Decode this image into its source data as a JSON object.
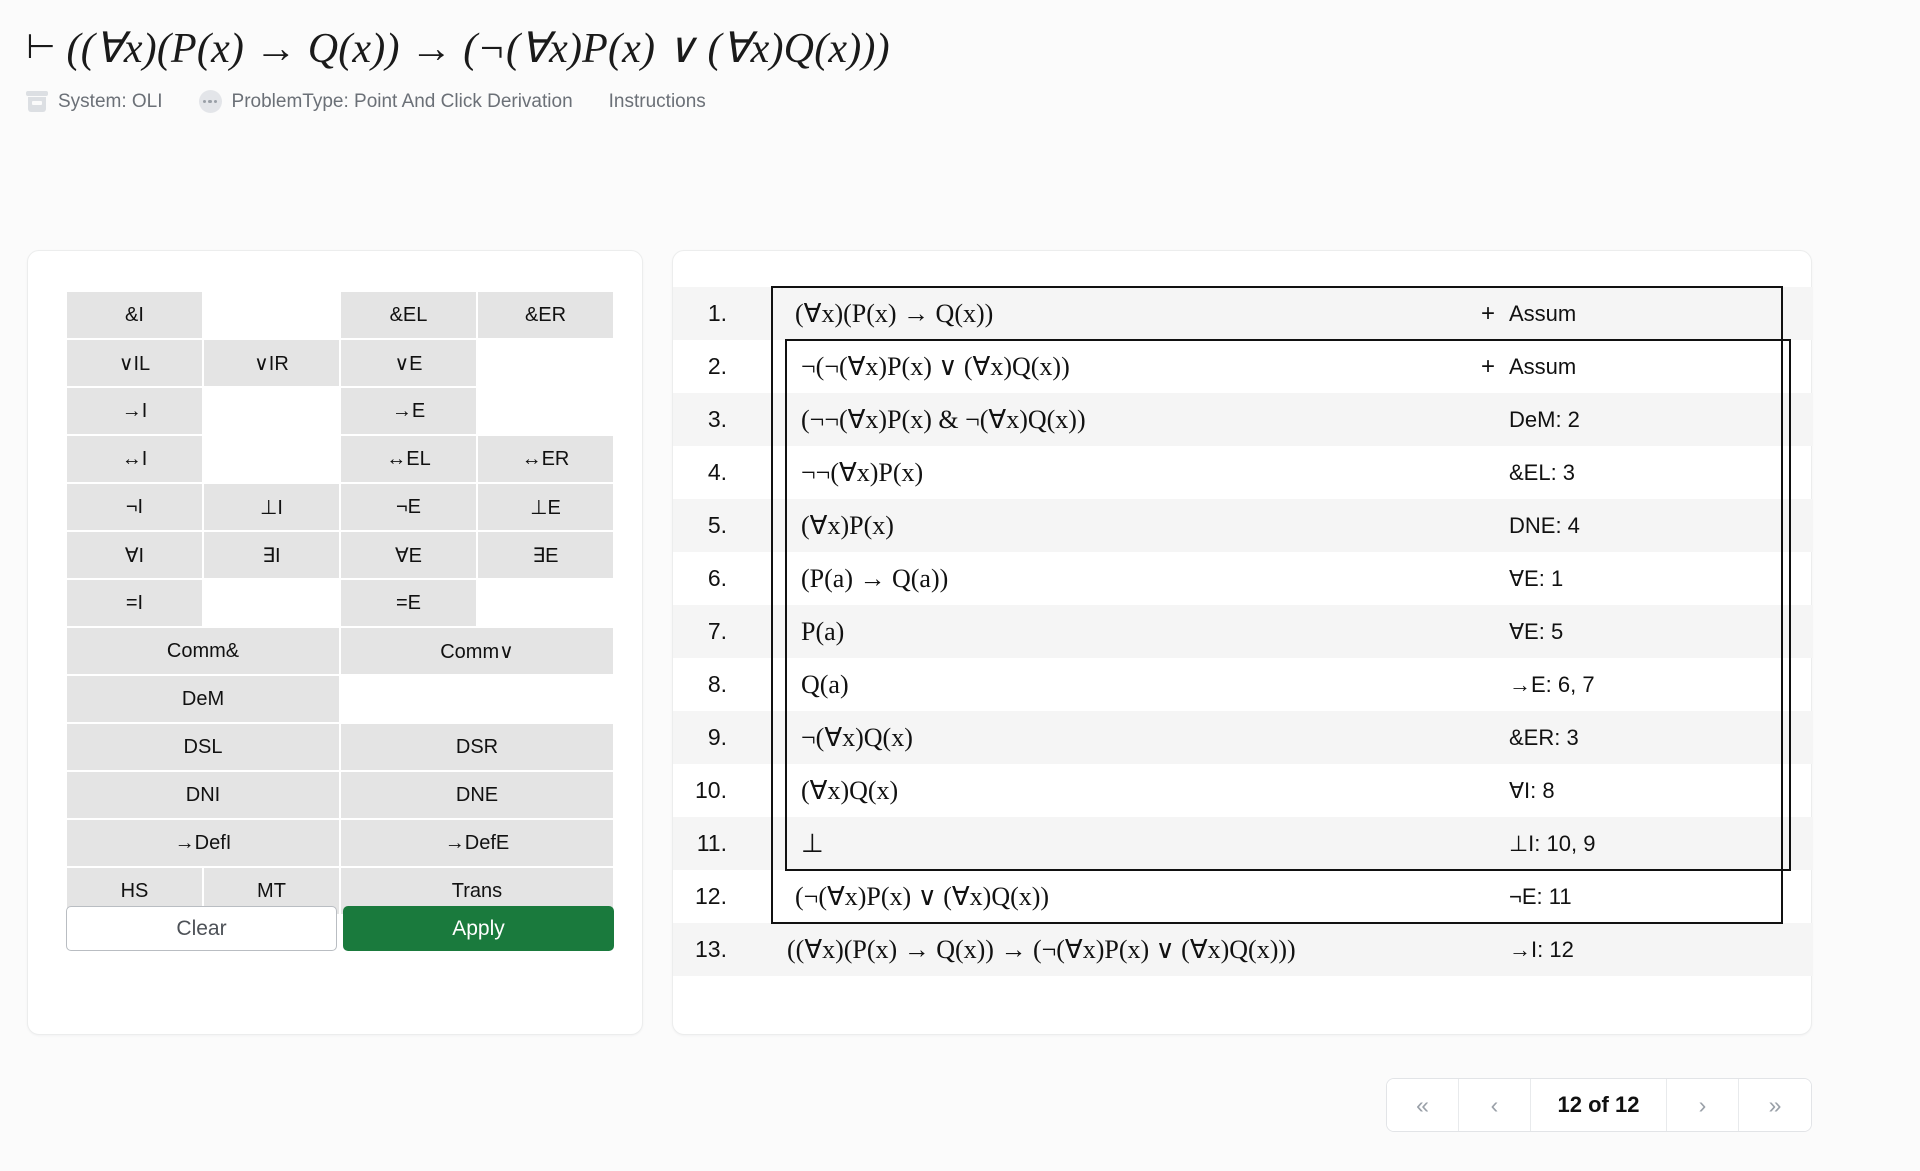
{
  "header": {
    "goal_turnstile": "⊢",
    "goal_formula": "((∀x)(P(x) → Q(x)) → (¬(∀x)P(x) ∨ (∀x)Q(x)))",
    "system_label": "System: OLI",
    "problem_type_label": "ProblemType: Point And Click Derivation",
    "instructions_label": "Instructions",
    "icons": {
      "system": "bucket-icon",
      "problem_type": "ellipsis-circle-icon"
    }
  },
  "rules_panel": {
    "rows": [
      [
        {
          "label": "&I",
          "span": 1
        },
        {
          "label": "",
          "span": 1,
          "empty": true
        },
        {
          "label": "&EL",
          "span": 1
        },
        {
          "label": "&ER",
          "span": 1
        }
      ],
      [
        {
          "label": "∨IL",
          "span": 1
        },
        {
          "label": "∨IR",
          "span": 1
        },
        {
          "label": "∨E",
          "span": 1
        },
        {
          "label": "",
          "span": 1,
          "empty": true
        }
      ],
      [
        {
          "label": "→I",
          "span": 1
        },
        {
          "label": "",
          "span": 1,
          "empty": true
        },
        {
          "label": "→E",
          "span": 1
        },
        {
          "label": "",
          "span": 1,
          "empty": true
        }
      ],
      [
        {
          "label": "↔I",
          "span": 1
        },
        {
          "label": "",
          "span": 1,
          "empty": true
        },
        {
          "label": "↔EL",
          "span": 1
        },
        {
          "label": "↔ER",
          "span": 1
        }
      ],
      [
        {
          "label": "¬I",
          "span": 1
        },
        {
          "label": "⊥I",
          "span": 1
        },
        {
          "label": "¬E",
          "span": 1
        },
        {
          "label": "⊥E",
          "span": 1
        }
      ],
      [
        {
          "label": "∀I",
          "span": 1
        },
        {
          "label": "∃I",
          "span": 1
        },
        {
          "label": "∀E",
          "span": 1
        },
        {
          "label": "∃E",
          "span": 1
        }
      ],
      [
        {
          "label": "=I",
          "span": 1
        },
        {
          "label": "",
          "span": 1,
          "empty": true
        },
        {
          "label": "=E",
          "span": 1
        },
        {
          "label": "",
          "span": 1,
          "empty": true
        }
      ],
      [
        {
          "label": "Comm&",
          "span": 2
        },
        {
          "label": "Comm∨",
          "span": 2
        }
      ],
      [
        {
          "label": "DeM",
          "span": 2
        },
        {
          "label": "",
          "span": 2,
          "empty": true
        }
      ],
      [
        {
          "label": "DSL",
          "span": 2
        },
        {
          "label": "DSR",
          "span": 2
        }
      ],
      [
        {
          "label": "DNI",
          "span": 2
        },
        {
          "label": "DNE",
          "span": 2
        }
      ],
      [
        {
          "label": "→DefI",
          "span": 2
        },
        {
          "label": "→DefE",
          "span": 2
        }
      ],
      [
        {
          "label": "HS",
          "span": 1
        },
        {
          "label": "MT",
          "span": 1
        },
        {
          "label": "Trans",
          "span": 2
        }
      ]
    ],
    "clear_label": "Clear",
    "apply_label": "Apply",
    "apply_color": "#1a7a3d"
  },
  "proof": {
    "lines": [
      {
        "n": "1.",
        "formula": "(∀x)(P(x) → Q(x))",
        "justification": "Assum",
        "plus": "+",
        "depth": 1
      },
      {
        "n": "2.",
        "formula": "¬(¬(∀x)P(x) ∨ (∀x)Q(x))",
        "justification": "Assum",
        "plus": "+",
        "depth": 2
      },
      {
        "n": "3.",
        "formula": "(¬¬(∀x)P(x) & ¬(∀x)Q(x))",
        "justification": "DeM: 2",
        "plus": "",
        "depth": 2
      },
      {
        "n": "4.",
        "formula": "¬¬(∀x)P(x)",
        "justification": "&EL: 3",
        "plus": "",
        "depth": 2
      },
      {
        "n": "5.",
        "formula": "(∀x)P(x)",
        "justification": "DNE: 4",
        "plus": "",
        "depth": 2
      },
      {
        "n": "6.",
        "formula": "(P(a) → Q(a))",
        "justification": "∀E: 1",
        "plus": "",
        "depth": 2
      },
      {
        "n": "7.",
        "formula": "P(a)",
        "justification": "∀E: 5",
        "plus": "",
        "depth": 2
      },
      {
        "n": "8.",
        "formula": "Q(a)",
        "justification": "→E: 6, 7",
        "plus": "",
        "depth": 2
      },
      {
        "n": "9.",
        "formula": "¬(∀x)Q(x)",
        "justification": "&ER: 3",
        "plus": "",
        "depth": 2
      },
      {
        "n": "10.",
        "formula": "(∀x)Q(x)",
        "justification": "∀I: 8",
        "plus": "",
        "depth": 2
      },
      {
        "n": "11.",
        "formula": "⊥",
        "justification": "⊥I: 10, 9",
        "plus": "",
        "depth": 2
      },
      {
        "n": "12.",
        "formula": "(¬(∀x)P(x) ∨ (∀x)Q(x))",
        "justification": "¬E: 11",
        "plus": "",
        "depth": 1
      },
      {
        "n": "13.",
        "formula": "((∀x)(P(x) → Q(x)) → (¬(∀x)P(x) ∨ (∀x)Q(x)))",
        "justification": "→I: 12",
        "plus": "",
        "depth": 0
      }
    ]
  },
  "pagination": {
    "first_label": "«",
    "prev_label": "‹",
    "page_label": "12 of 12",
    "next_label": "›",
    "last_label": "»"
  }
}
